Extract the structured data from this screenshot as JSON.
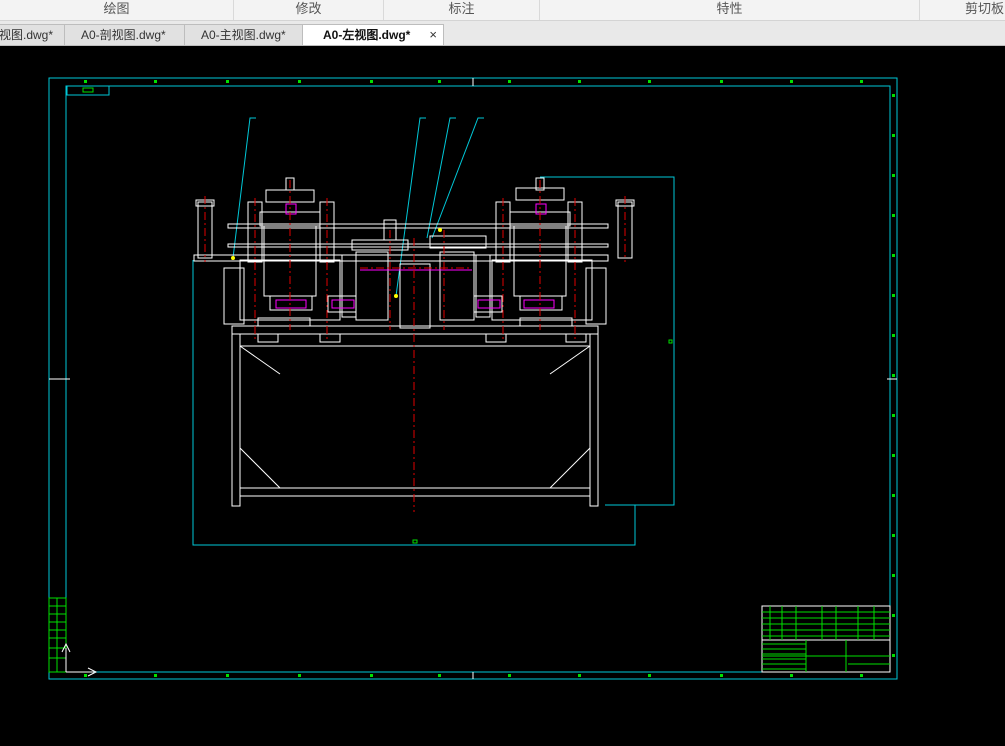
{
  "ribbon": {
    "panels": [
      "绘图",
      "修改",
      "标注",
      "特性",
      "剪切板"
    ]
  },
  "tabs": [
    {
      "label": "视图.dwg*"
    },
    {
      "label": "A0-剖视图.dwg*"
    },
    {
      "label": "A0-主视图.dwg*"
    },
    {
      "label": "A0-左视图.dwg*",
      "active": true,
      "close_icon": "×"
    }
  ],
  "colors": {
    "background": "#000000",
    "frame": "#00c8d8",
    "linework": "#ffffff",
    "centerline": "#e00000",
    "titleblock": "#00e000",
    "accent": "#ff00ff"
  },
  "icons": {
    "ucs": "ucs-axis-icon",
    "close": "close-icon"
  }
}
